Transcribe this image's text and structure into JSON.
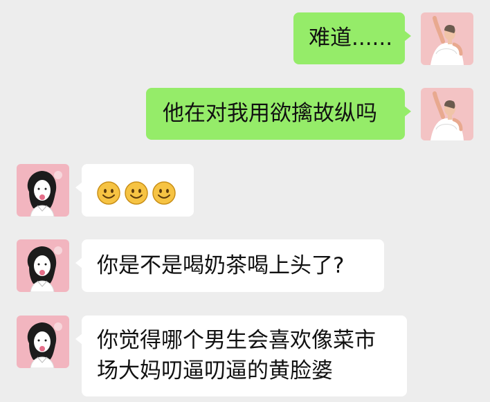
{
  "messages": [
    {
      "side": "outgoing",
      "text": "难道......"
    },
    {
      "side": "outgoing",
      "text": "他在对我用欲擒故纵吗"
    },
    {
      "side": "incoming",
      "type": "emoji",
      "emoji_count": 3,
      "emoji_icon": "smile-emoji-icon"
    },
    {
      "side": "incoming",
      "text": "你是不是喝奶茶喝上头了?"
    },
    {
      "side": "incoming",
      "lines": [
        "你觉得哪个男生会喜欢像菜市",
        "场大妈叨逼叨逼的黄脸婆"
      ]
    }
  ],
  "colors": {
    "background": "#ededed",
    "outgoing_bubble": "#95ec69",
    "incoming_bubble": "#ffffff",
    "avatar_bg": "#f2b5bf"
  }
}
